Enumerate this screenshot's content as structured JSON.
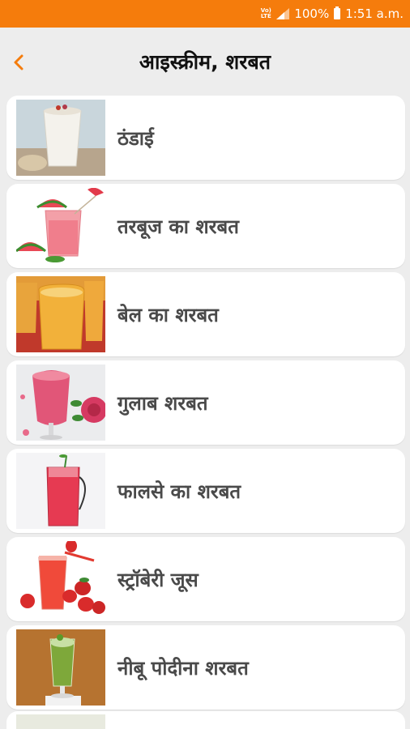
{
  "status_bar": {
    "volte": "Vo) LTE",
    "battery": "100%",
    "time": "1:51 a.m."
  },
  "header": {
    "title": "आइस्क्रीम, शरबत",
    "back_icon": "chevron-left-icon"
  },
  "colors": {
    "accent": "#f57c0c",
    "background": "#ededed",
    "card": "#ffffff",
    "label": "#4a4a4a"
  },
  "items": [
    {
      "label": "ठंडाई",
      "image": "thandai-drink"
    },
    {
      "label": "तरबूज का शरबत",
      "image": "watermelon-juice"
    },
    {
      "label": "बेल का शरबत",
      "image": "bael-juice"
    },
    {
      "label": "गुलाब शरबत",
      "image": "rose-sharbat"
    },
    {
      "label": "फालसे का शरबत",
      "image": "phalsa-sharbat"
    },
    {
      "label": "स्ट्रॉबेरी जूस",
      "image": "strawberry-juice"
    },
    {
      "label": "नीबू पोदीना शरबत",
      "image": "lemon-mint-sharbat"
    }
  ]
}
